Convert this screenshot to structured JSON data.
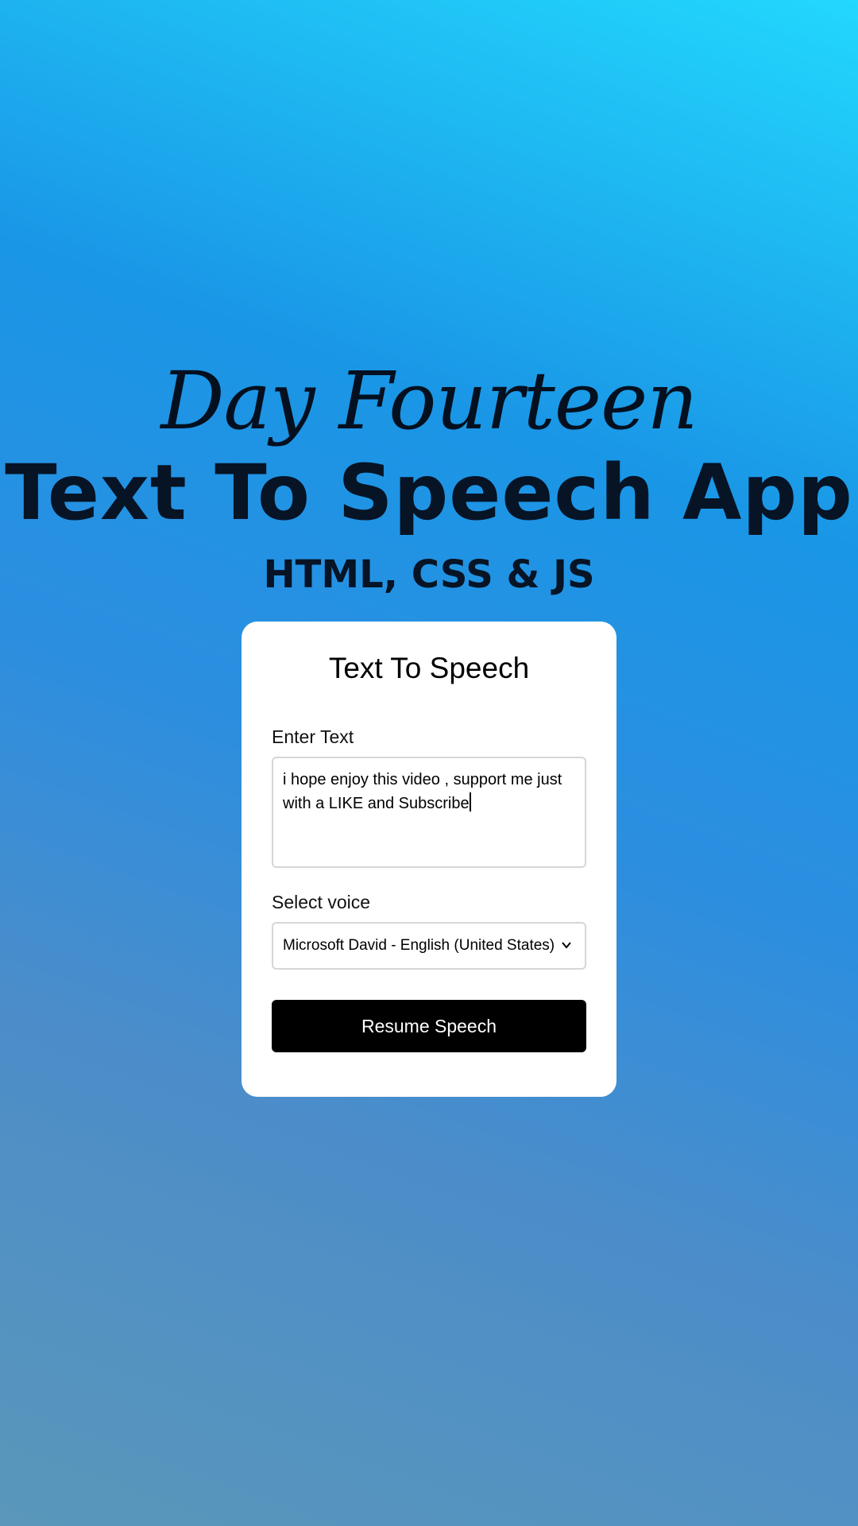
{
  "hero": {
    "script_title": "Day Fourteen",
    "main_title": "Text To Speech App",
    "sub_title": "HTML, CSS & JS"
  },
  "card": {
    "title": "Text To Speech",
    "text_label": "Enter Text",
    "text_value": "i hope enjoy this video , support me just with a LIKE and Subscribe",
    "voice_label": "Select voice",
    "voice_selected": "Microsoft David - English (United States)",
    "button_label": "Resume Speech",
    "chevron_icon": "chevron-down-icon"
  },
  "colors": {
    "gradient_top": "#22d8fd",
    "gradient_mid": "#1a96e6",
    "gradient_bottom": "#5a97ba",
    "title_text": "#061425",
    "button_bg": "#000000",
    "button_text": "#ffffff"
  }
}
